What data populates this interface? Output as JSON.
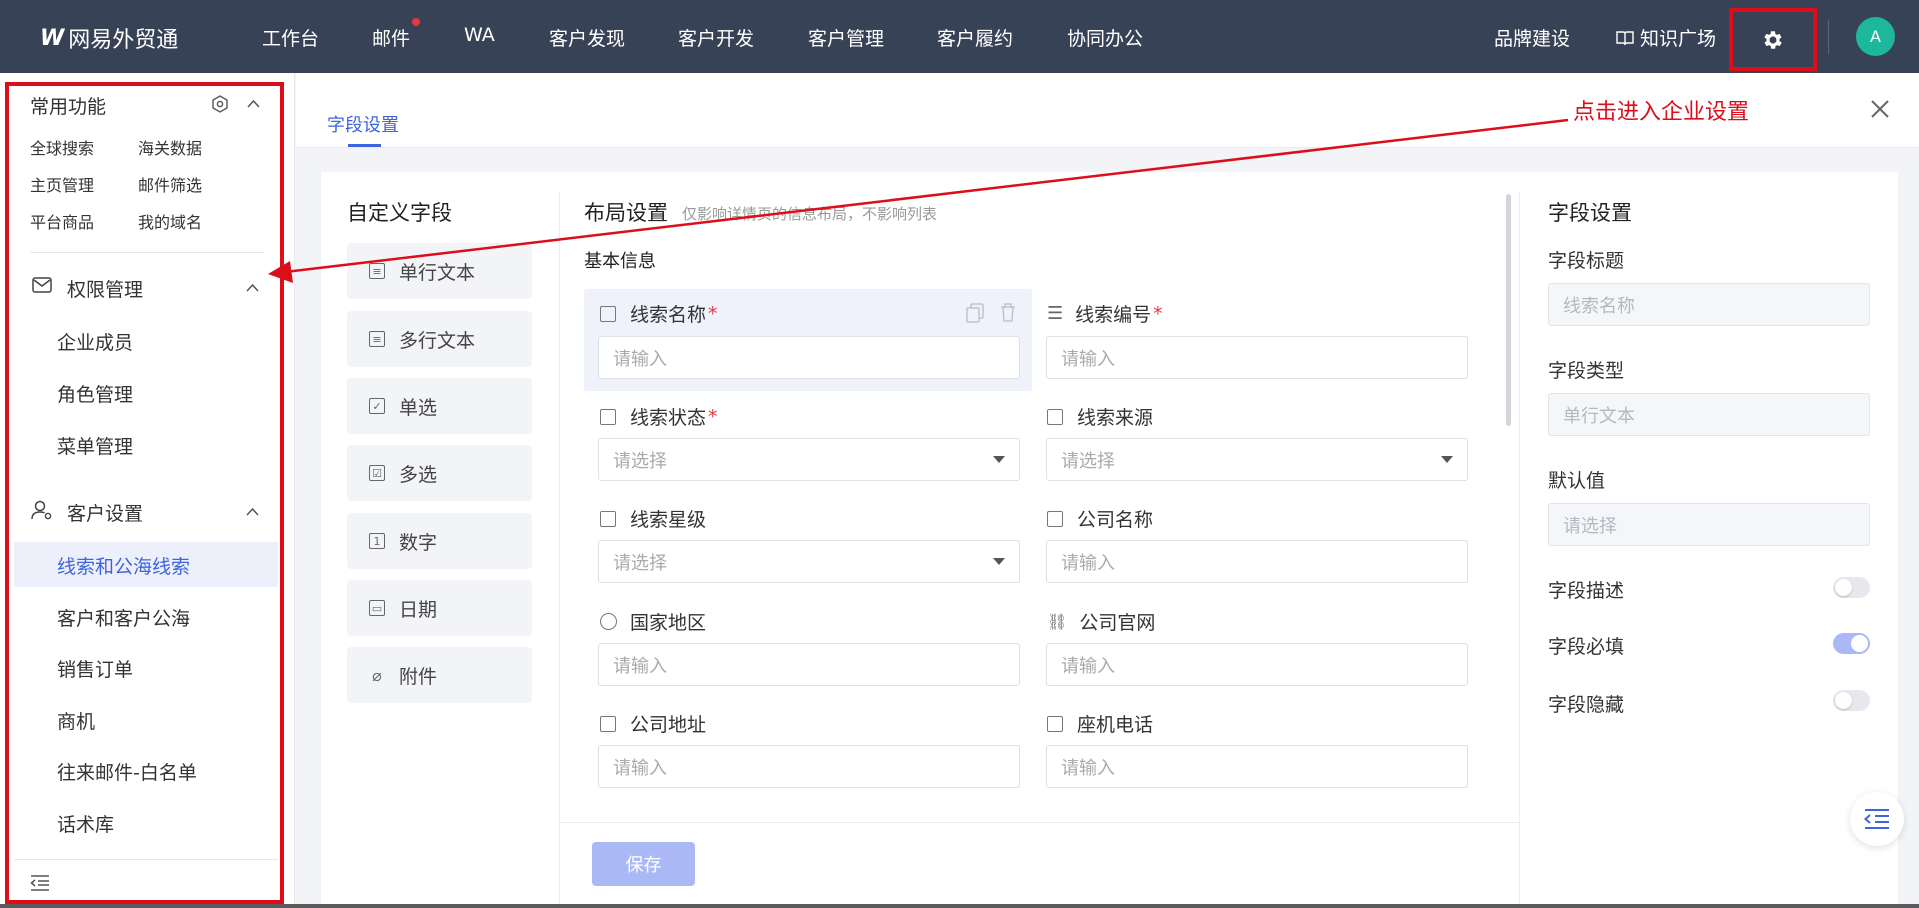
{
  "colors": {
    "topbar_bg": "#384256",
    "accent": "#3e64e0",
    "accent_light": "#aab9f5",
    "annotation_red": "#dd0d1a",
    "notify_dot": "#e8363c",
    "avatar_bg": "#1db89b"
  },
  "header": {
    "logo": "网易外贸通",
    "nav": [
      "工作台",
      "邮件",
      "WA",
      "客户发现",
      "客户开发",
      "客户管理",
      "客户履约",
      "协同办公"
    ],
    "brand": "品牌建设",
    "knowledge": "知识广场",
    "avatar": "A",
    "settings_icon": "gear-icon"
  },
  "sidebar": {
    "quick_title": "常用功能",
    "quick_links": [
      "全球搜索",
      "海关数据",
      "主页管理",
      "邮件筛选",
      "平台商品",
      "我的域名"
    ],
    "groups": [
      {
        "title": "权限管理",
        "icon": "mail-icon",
        "items": [
          "企业成员",
          "角色管理",
          "菜单管理"
        ]
      },
      {
        "title": "客户设置",
        "icon": "user-settings-icon",
        "items": [
          "线索和公海线索",
          "客户和客户公海",
          "销售订单",
          "商机",
          "往来邮件-白名单",
          "话术库"
        ]
      }
    ],
    "active_item": "线索和公海线索"
  },
  "tabs": {
    "active": "字段设置"
  },
  "annotation": "点击进入企业设置",
  "custom_fields": {
    "title": "自定义字段",
    "types": [
      "单行文本",
      "多行文本",
      "单选",
      "多选",
      "数字",
      "日期",
      "附件"
    ]
  },
  "layout": {
    "title": "布局设置",
    "subtitle": "仅影响详情页的信息布局，不影响列表",
    "section": "基本信息",
    "fields": [
      {
        "label": "线索名称",
        "required": true,
        "placeholder": "请输入",
        "kind": "input"
      },
      {
        "label": "线索编号",
        "required": true,
        "placeholder": "请输入",
        "kind": "input"
      },
      {
        "label": "线索状态",
        "required": true,
        "placeholder": "请选择",
        "kind": "select"
      },
      {
        "label": "线索来源",
        "required": false,
        "placeholder": "请选择",
        "kind": "select"
      },
      {
        "label": "线索星级",
        "required": false,
        "placeholder": "请选择",
        "kind": "select"
      },
      {
        "label": "公司名称",
        "required": false,
        "placeholder": "请输入",
        "kind": "input"
      },
      {
        "label": "国家地区",
        "required": false,
        "placeholder": "请输入",
        "kind": "input"
      },
      {
        "label": "公司官网",
        "required": false,
        "placeholder": "请输入",
        "kind": "input"
      },
      {
        "label": "公司地址",
        "required": false,
        "placeholder": "请输入",
        "kind": "input"
      },
      {
        "label": "座机电话",
        "required": false,
        "placeholder": "请输入",
        "kind": "input"
      }
    ],
    "required_mark": "*",
    "save": "保存"
  },
  "field_settings": {
    "title": "字段设置",
    "title_label": "字段标题",
    "title_value": "线索名称",
    "type_label": "字段类型",
    "type_value": "单行文本",
    "default_label": "默认值",
    "default_placeholder": "请选择",
    "toggles": [
      {
        "label": "字段描述",
        "on": false
      },
      {
        "label": "字段必填",
        "on": true
      },
      {
        "label": "字段隐藏",
        "on": false
      }
    ]
  }
}
